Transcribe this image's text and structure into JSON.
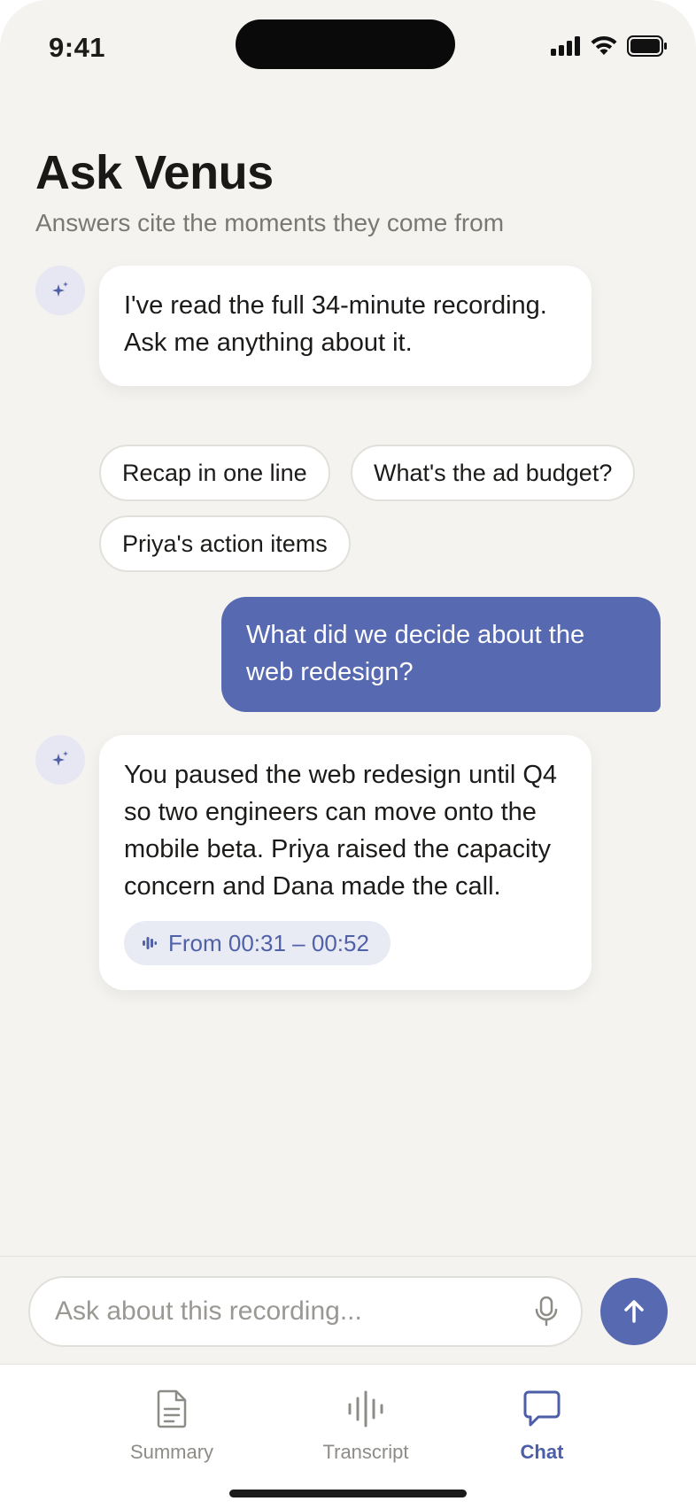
{
  "status_bar": {
    "time": "9:41"
  },
  "header": {
    "title": "Ask Venus",
    "subtitle": "Answers cite the moments they come from"
  },
  "messages": [
    {
      "role": "assistant",
      "text": "I've read the full 34-minute recording. Ask me anything about it."
    },
    {
      "role": "user",
      "text": "What did we decide about the web redesign?"
    },
    {
      "role": "assistant",
      "text": "You paused the web redesign until Q4 so two engineers can move onto the mobile beta. Priya raised the capacity concern and Dana made the call.",
      "citation": "From 00:31 – 00:52"
    }
  ],
  "suggestions": [
    "Recap in one line",
    "What's the ad budget?",
    "Priya's action items"
  ],
  "composer": {
    "placeholder": "Ask about this recording..."
  },
  "tabs": [
    {
      "label": "Summary",
      "icon": "document-icon",
      "active": false
    },
    {
      "label": "Transcript",
      "icon": "waveform-icon",
      "active": false
    },
    {
      "label": "Chat",
      "icon": "chat-bubble-icon",
      "active": true
    }
  ],
  "colors": {
    "accent": "#5769b0",
    "background": "#f4f3f0",
    "citation_bg": "#e8eaf4"
  }
}
